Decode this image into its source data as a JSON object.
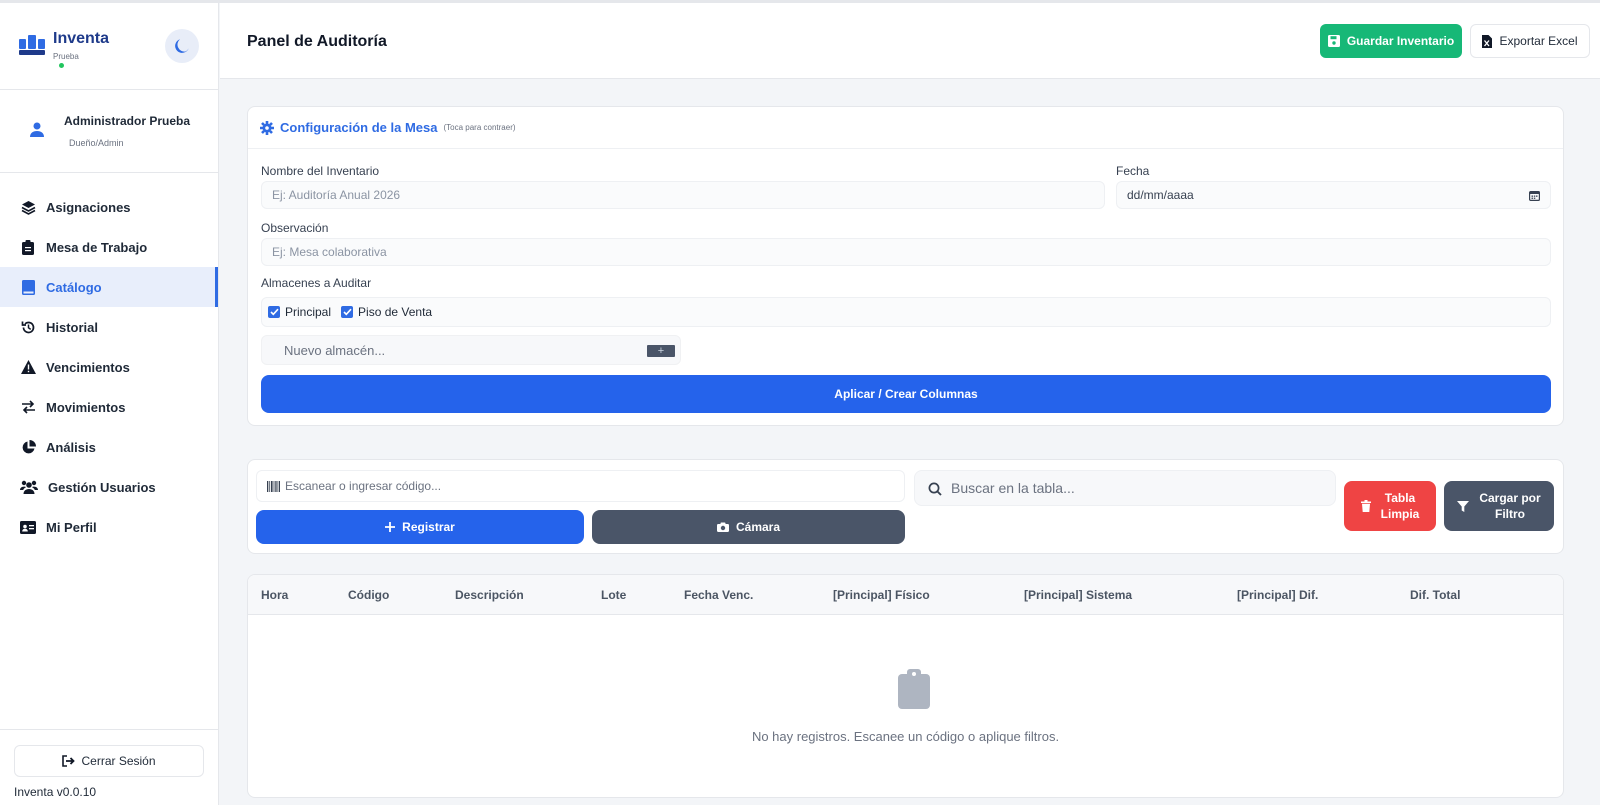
{
  "brand": {
    "name": "Inventa",
    "env": "Prueba"
  },
  "user": {
    "name": "Administrador Prueba",
    "role": "Dueño/Admin"
  },
  "nav": [
    {
      "label": "Asignaciones",
      "icon": "layers-icon"
    },
    {
      "label": "Mesa de Trabajo",
      "icon": "clipboard-icon"
    },
    {
      "label": "Catálogo",
      "icon": "book-icon",
      "active": true
    },
    {
      "label": "Historial",
      "icon": "history-icon"
    },
    {
      "label": "Vencimientos",
      "icon": "warning-icon"
    },
    {
      "label": "Movimientos",
      "icon": "swap-icon"
    },
    {
      "label": "Análisis",
      "icon": "pie-chart-icon"
    },
    {
      "label": "Gestión Usuarios",
      "icon": "users-icon"
    },
    {
      "label": "Mi Perfil",
      "icon": "id-card-icon"
    }
  ],
  "sidebar_footer": {
    "logout_label": "Cerrar Sesión",
    "version": "Inventa v0.0.10"
  },
  "header": {
    "title": "Panel de Auditoría",
    "save_label": "Guardar Inventario",
    "export_label": "Exportar Excel"
  },
  "config": {
    "title": "Configuración de la Mesa",
    "hint": "(Toca para contraer)",
    "name_label": "Nombre del Inventario",
    "name_placeholder": "Ej: Auditoría Anual 2026",
    "date_label": "Fecha",
    "date_placeholder": "dd/mm/aaaa",
    "obs_label": "Observación",
    "obs_placeholder": "Ej: Mesa colaborativa",
    "warehouses_label": "Almacenes a Auditar",
    "warehouses": [
      {
        "label": "Principal",
        "checked": true
      },
      {
        "label": "Piso de Venta",
        "checked": true
      }
    ],
    "new_warehouse_placeholder": "Nuevo almacén...",
    "add_label": "+",
    "apply_label": "Aplicar / Crear Columnas"
  },
  "scanner": {
    "scan_placeholder": "Escanear o ingresar código...",
    "register_label": "Registrar",
    "camera_label": "Cámara",
    "search_placeholder": "Buscar en la tabla...",
    "clean_label_1": "Tabla",
    "clean_label_2": "Limpia",
    "filter_label_1": "Cargar por",
    "filter_label_2": "Filtro"
  },
  "table": {
    "columns": [
      "Hora",
      "Código",
      "Descripción",
      "Lote",
      "Fecha Venc.",
      "[Principal] Físico",
      "[Principal] Sistema",
      "[Principal] Dif.",
      "Dif. Total"
    ],
    "empty_text": "No hay registros. Escanee un código o aplique filtros."
  },
  "colors": {
    "primary": "#2563eb",
    "success": "#17b877",
    "danger": "#ef4444",
    "slate": "#4a5568"
  }
}
